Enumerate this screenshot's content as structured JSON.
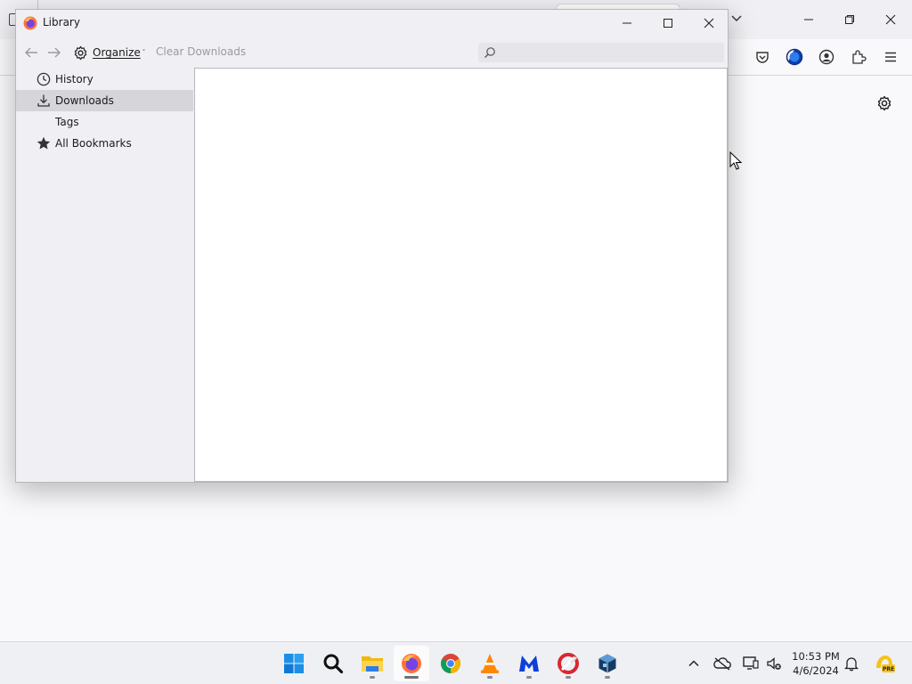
{
  "library_window": {
    "title": "Library",
    "toolbar": {
      "organize_label": "Organize",
      "organize_caret": "˅",
      "clear_downloads_label": "Clear Downloads",
      "search_placeholder": ""
    },
    "sidebar": {
      "items": [
        {
          "label": "History",
          "icon": "clock-icon",
          "selected": false
        },
        {
          "label": "Downloads",
          "icon": "download-icon",
          "selected": true
        },
        {
          "label": "Tags",
          "icon": "none",
          "selected": false
        },
        {
          "label": "All Bookmarks",
          "icon": "star-icon",
          "selected": false
        }
      ]
    }
  },
  "background_browser": {
    "toolbar_icons": [
      "pocket-icon",
      "container-icon",
      "account-icon",
      "extensions-icon",
      "menu-icon"
    ],
    "settings_icon": "gear-icon"
  },
  "taskbar": {
    "apps": [
      "windows-start-icon",
      "search-icon",
      "file-explorer-icon",
      "firefox-icon",
      "chrome-icon",
      "vlc-icon",
      "malwarebytes-icon",
      "ccleaner-icon",
      "virtualbox-icon"
    ],
    "active_app": "firefox-icon",
    "tray": {
      "time": "10:53 PM",
      "date": "4/6/2024",
      "badge": "PRE"
    }
  },
  "colors": {
    "accent_blue": "#0060df",
    "selection_gray": "#d6d6da",
    "firefox_orange": "#ff7139"
  }
}
